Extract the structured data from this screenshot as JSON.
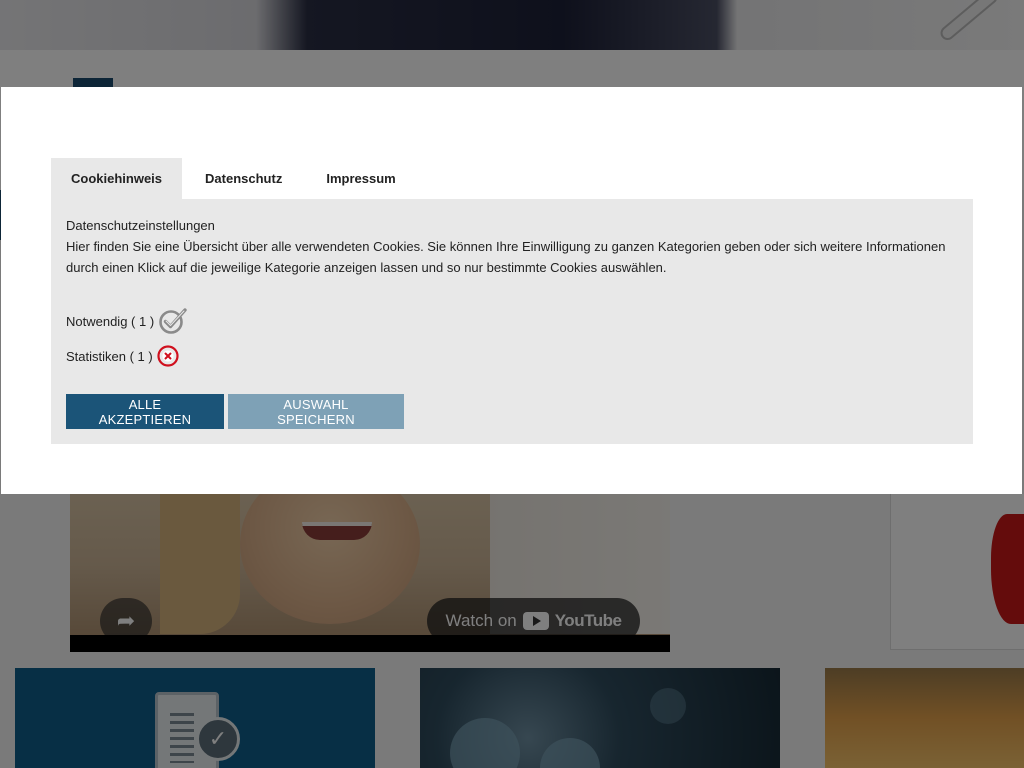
{
  "background": {
    "video": {
      "share_glyph": "➦",
      "watch_label": "Watch on",
      "youtube_label": "YouTube"
    },
    "tiles": {
      "check_glyph": "✓"
    }
  },
  "cookie_modal": {
    "tabs": [
      {
        "label": "Cookiehinweis",
        "active": true
      },
      {
        "label": "Datenschutz",
        "active": false
      },
      {
        "label": "Impressum",
        "active": false
      }
    ],
    "title": "Datenschutzeinstellungen",
    "description": "Hier finden Sie eine Übersicht über alle verwendeten Cookies. Sie können Ihre Einwilligung zu ganzen Kategorien geben oder sich weitere Informationen durch einen Klick auf die jeweilige Kategorie anzeigen lassen und so nur bestimmte Cookies auswählen.",
    "categories": [
      {
        "label": "Notwendig ( 1 )",
        "status_icon": "check-icon",
        "accepted": true
      },
      {
        "label": "Statistiken ( 1 )",
        "status_icon": "cross-circle-icon",
        "accepted": false
      }
    ],
    "buttons": {
      "accept_all": "ALLE AKZEPTIEREN",
      "save_selection": "AUSWAHL SPEICHERN"
    },
    "colors": {
      "accept_button": "#1b5478",
      "save_button": "#7ea1b6",
      "panel_background": "#e8e8e8",
      "cross_icon": "#d0101e",
      "check_icon": "#8a8a8a"
    }
  }
}
